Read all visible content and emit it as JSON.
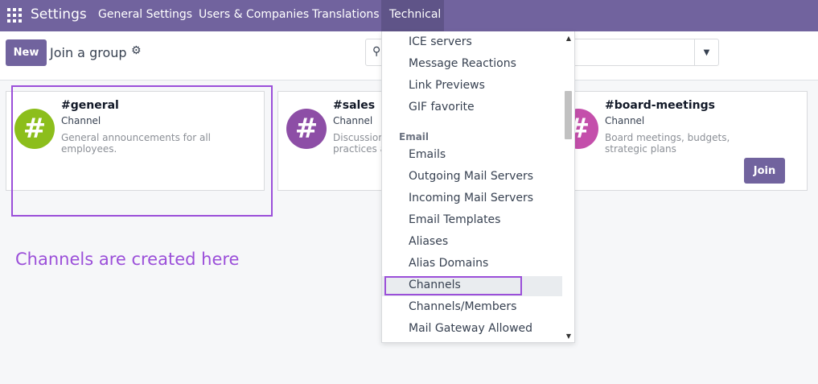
{
  "navbar": {
    "brand": "Settings",
    "items": [
      "General Settings",
      "Users & Companies",
      "Translations",
      "Technical"
    ],
    "active_item": "Technical"
  },
  "control_panel": {
    "new_label": "New",
    "title": "Join a group"
  },
  "cards": [
    {
      "title": "#general",
      "subtitle": "Channel",
      "description": "General announcements for all employees.",
      "avatar_symbol": "#",
      "color": "#8cbe1c"
    },
    {
      "title": "#sales",
      "subtitle": "Channel",
      "description": "Discussion about best sales practices and deals.",
      "avatar_symbol": "#",
      "color": "#8d4ea6"
    },
    {
      "title": "#board-meetings",
      "subtitle": "Channel",
      "description": "Board meetings, budgets, strategic plans",
      "avatar_symbol": "#",
      "color": "#c44fab",
      "button": "Join"
    }
  ],
  "annotation": "Channels are created here",
  "technical_menu": {
    "items_top": [
      "ICE servers",
      "Message Reactions",
      "Link Previews",
      "GIF favorite"
    ],
    "email_header": "Email",
    "email_items": [
      "Emails",
      "Outgoing Mail Servers",
      "Incoming Mail Servers",
      "Email Templates",
      "Aliases",
      "Alias Domains",
      "Channels",
      "Channels/Members",
      "Mail Gateway Allowed"
    ],
    "selected_item": "Channels"
  },
  "colors": {
    "brand": "#71639e",
    "highlight": "#9b4fd9"
  }
}
